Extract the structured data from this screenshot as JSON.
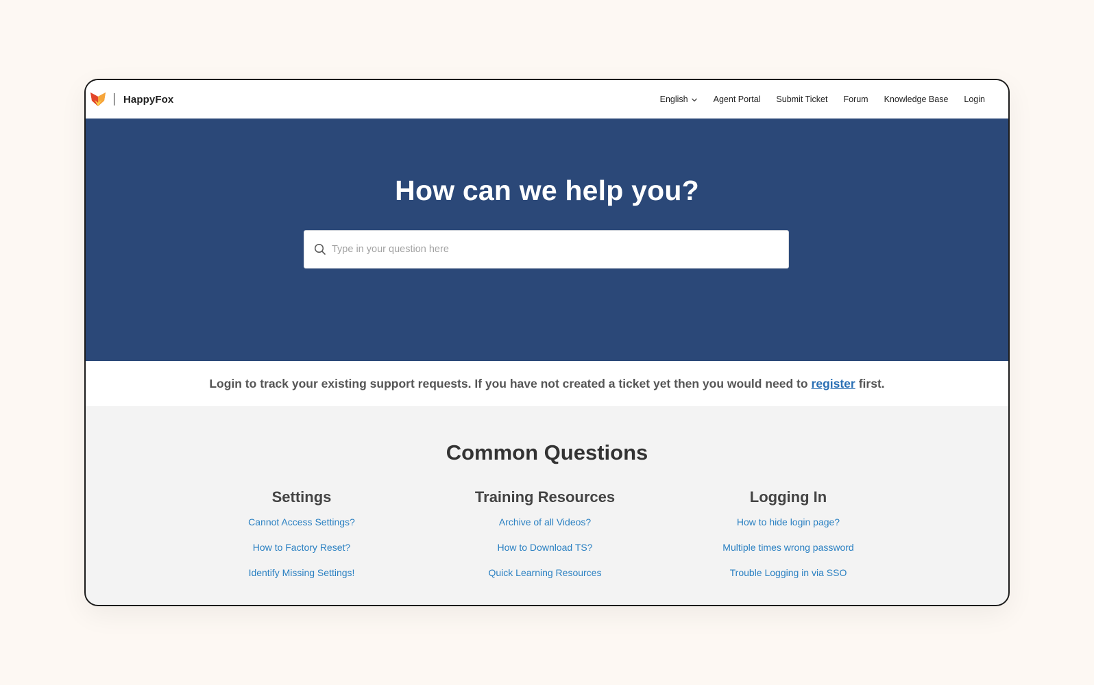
{
  "header": {
    "brand": "HappyFox",
    "logo_icon": "fox-icon",
    "nav": {
      "language": "English",
      "agent_portal": "Agent Portal",
      "submit_ticket": "Submit Ticket",
      "forum": "Forum",
      "knowledge_base": "Knowledge Base",
      "login": "Login"
    }
  },
  "hero": {
    "title": "How can we help you?",
    "search_placeholder": "Type in your question here",
    "search_icon": "search-icon",
    "background_color": "#2b4878"
  },
  "notice": {
    "text_before": "Login to track your existing support requests. If you have not created a ticket yet then you would need to",
    "link": "register",
    "text_after": "first."
  },
  "common_questions": {
    "title": "Common Questions",
    "columns": [
      {
        "title": "Settings",
        "links": [
          "Cannot Access Settings?",
          "How to Factory Reset?",
          "Identify Missing Settings!"
        ]
      },
      {
        "title": "Training Resources",
        "links": [
          "Archive of all Videos?",
          "How to Download TS?",
          "Quick Learning Resources"
        ]
      },
      {
        "title": "Logging In",
        "links": [
          "How to hide login page?",
          "Multiple times wrong password",
          "Trouble Logging in via SSO"
        ]
      }
    ]
  },
  "colors": {
    "link": "#2a80c2",
    "accent_orange": "#f0812a",
    "page_background": "#fdf8f3"
  }
}
